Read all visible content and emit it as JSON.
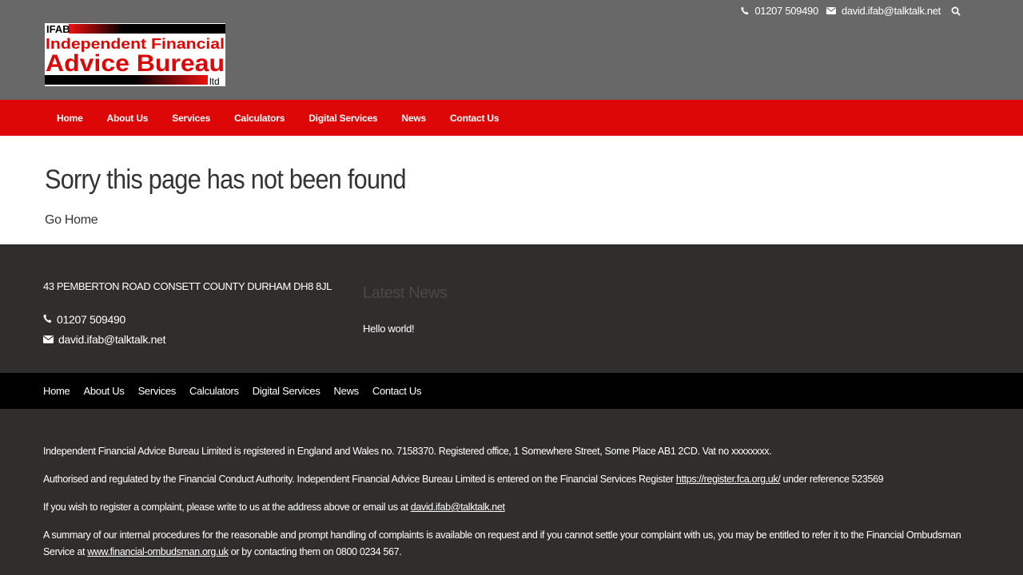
{
  "top": {
    "phone": "01207 509490",
    "email": "david.ifab@talktalk.net"
  },
  "logo": {
    "line1": "IFAB",
    "line2": "Independent Financial",
    "line3": "Advice Bureau",
    "line4": "ltd"
  },
  "nav": {
    "items": [
      "Home",
      "About Us",
      "Services",
      "Calculators",
      "Digital Services",
      "News",
      "Contact Us"
    ]
  },
  "main": {
    "heading": "Sorry this page has not been found",
    "link": "Go Home"
  },
  "footer": {
    "address": "43 PEMBERTON ROAD CONSETT COUNTY DURHAM DH8 8JL",
    "phone": "01207 509490",
    "email": "david.ifab@talktalk.net",
    "news_title": "Latest News",
    "news_items": [
      "Hello world!"
    ]
  },
  "footer_nav": {
    "items": [
      "Home",
      "About Us",
      "Services",
      "Calculators",
      "Digital Services",
      "News",
      "Contact Us"
    ]
  },
  "legal": {
    "p1": "Independent Financial Advice Bureau Limited is registered in England and Wales no. 7158370. Registered office, 1 Somewhere Street, Some Place AB1 2CD. Vat no xxxxxxxx.",
    "p2_before": "Authorised and regulated by the Financial Conduct Authority. Independent Financial Advice Bureau Limited is entered on the Financial Services Register ",
    "p2_link": "https://register.fca.org.uk/",
    "p2_after": " under reference 523569",
    "p3_before": "If you wish to register a complaint, please write to us at the address above or email us at ",
    "p3_link": "david.ifab@talktalk.net",
    "p4_before": "A summary of our internal procedures for the reasonable and prompt handling of complaints is available on request and if you cannot settle your complaint with us, you may be entitled to refer it to the Financial Ombudsman Service at ",
    "p4_link": "www.financial-ombudsman.org.uk",
    "p4_after": " or by contacting them on 0800 0234 567."
  },
  "colors": {
    "topbar": "#686868",
    "nav": "#dd0707",
    "footer": "#302e2d",
    "footer_nav": "#000000"
  }
}
